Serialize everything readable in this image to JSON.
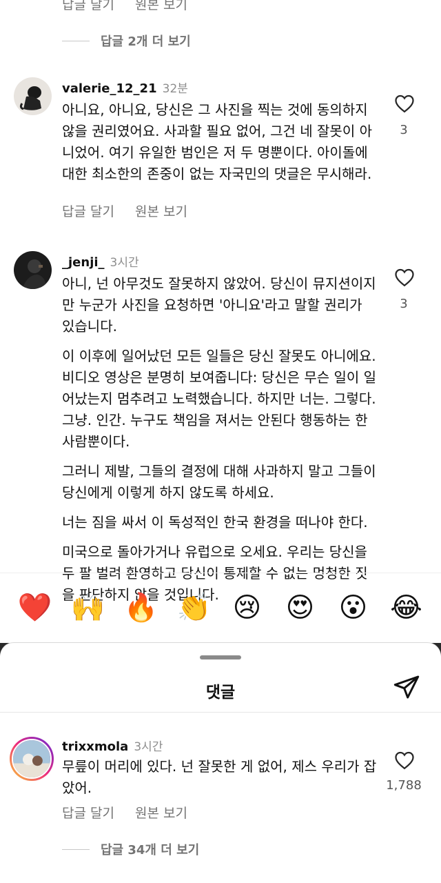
{
  "top_actions": {
    "reply": "답글 달기",
    "original": "원본 보기"
  },
  "more_replies_1": "답글 2개 더 보기",
  "comments": [
    {
      "username": "valerie_12_21",
      "time": "32분",
      "text": [
        "아니요, 아니요, 당신은 그 사진을 찍는 것에 동의하지 않을 권리였어요. 사과할 필요 없어, 그건 네 잘못이 아니었어. 여기 유일한 범인은 저 두 명뿐이다. 아이돌에 대한 최소한의 존중이 없는 자국민의 댓글은 무시해라."
      ],
      "likes": "3",
      "reply_label": "답글 달기",
      "original_label": "원본 보기"
    },
    {
      "username": "_jenji_",
      "time": "3시간",
      "paragraphs": [
        "아니, 넌 아무것도 잘못하지 않았어. 당신이 뮤지션이지만 누군가 사진을 요청하면 '아니요'라고 말할 권리가 있습니다.",
        "이 이후에 일어났던 모든 일들은 당신 잘못도 아니에요. 비디오 영상은 분명히 보여줍니다: 당신은 무슨 일이 일어났는지 멈추려고 노력했습니다. 하지만 너는. 그렇다. 그냥. 인간. 누구도 책임을 져서는 안된다 행동하는 한 사람뿐이다.",
        "그러니 제발, 그들의 결정에 대해 사과하지 말고 그들이 당신에게 이렇게 하지 않도록 하세요.",
        "너는 짐을 싸서 이 독성적인 한국 환경을 떠나야 한다.",
        "미국으로 돌아가거나 유럽으로 오세요. 우리는 당신을 두 팔 벌려 환영하고 당신이 통제할 수 없는 멍청한 짓을 판단하지 않을 것입니다."
      ],
      "likes": "3"
    }
  ],
  "emojis": [
    "❤️",
    "🙌",
    "🔥",
    "👏",
    "😢",
    "😍",
    "😮",
    "😂"
  ],
  "sheet": {
    "title": "댓글",
    "comment": {
      "username": "trixxmola",
      "time": "3시간",
      "text": "무릎이 머리에 있다. 넌 잘못한 게 없어, 제스 우리가 잡았어.",
      "likes": "1,788",
      "reply_label": "답글 달기",
      "original_label": "원본 보기"
    },
    "more_replies": "답글 34개 더 보기"
  },
  "colors": {
    "secondary_text": "#737373",
    "heart_outline": "#262626"
  }
}
